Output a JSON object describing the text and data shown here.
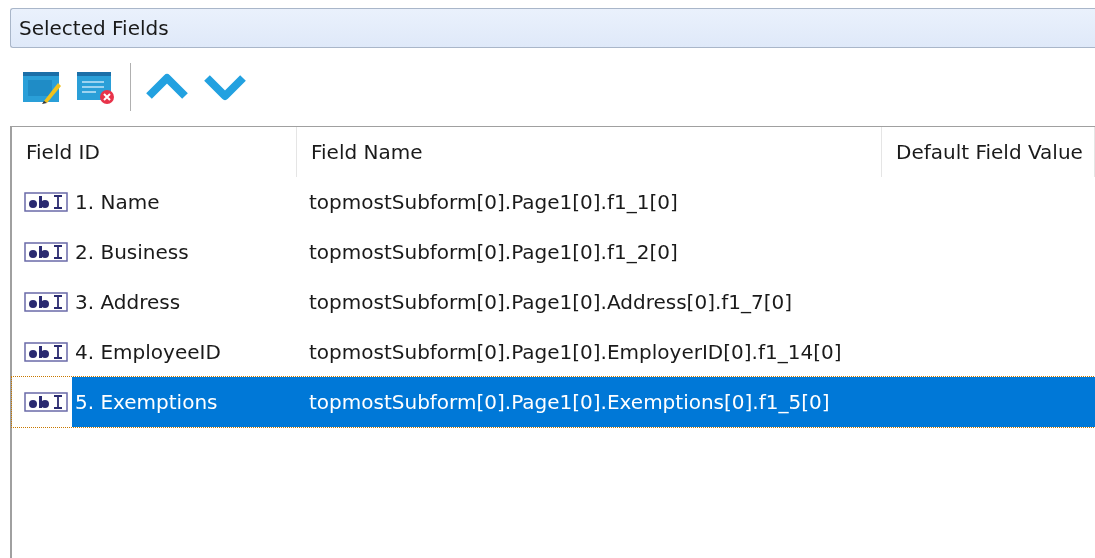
{
  "panel_title": "Selected Fields",
  "columns": [
    "Field ID",
    "Field Name",
    "Default Field Value"
  ],
  "rows": [
    {
      "field_id": "1. Name",
      "field_name": "topmostSubform[0].Page1[0].f1_1[0]",
      "selected": false
    },
    {
      "field_id": "2. Business",
      "field_name": "topmostSubform[0].Page1[0].f1_2[0]",
      "selected": false
    },
    {
      "field_id": "3. Address",
      "field_name": "topmostSubform[0].Page1[0].Address[0].f1_7[0]",
      "selected": false
    },
    {
      "field_id": "4. EmployeeID",
      "field_name": "topmostSubform[0].Page1[0].EmployerID[0].f1_14[0]",
      "selected": false
    },
    {
      "field_id": "5. Exemptions",
      "field_name": "topmostSubform[0].Page1[0].Exemptions[0].f1_5[0]",
      "selected": true
    }
  ]
}
